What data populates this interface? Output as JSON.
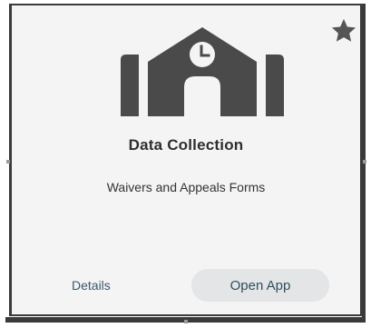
{
  "card": {
    "title": "Data Collection",
    "subtitle": "Waivers and Appeals Forms",
    "favorite_icon": "star-icon",
    "app_icon": "building-clock-icon",
    "actions": {
      "details_label": "Details",
      "open_label": "Open App"
    }
  },
  "colors": {
    "icon": "#4a4a4a",
    "card_background": "#f4f4f4",
    "button_background": "#e3e5e6",
    "link_text": "#3a5a6a"
  }
}
